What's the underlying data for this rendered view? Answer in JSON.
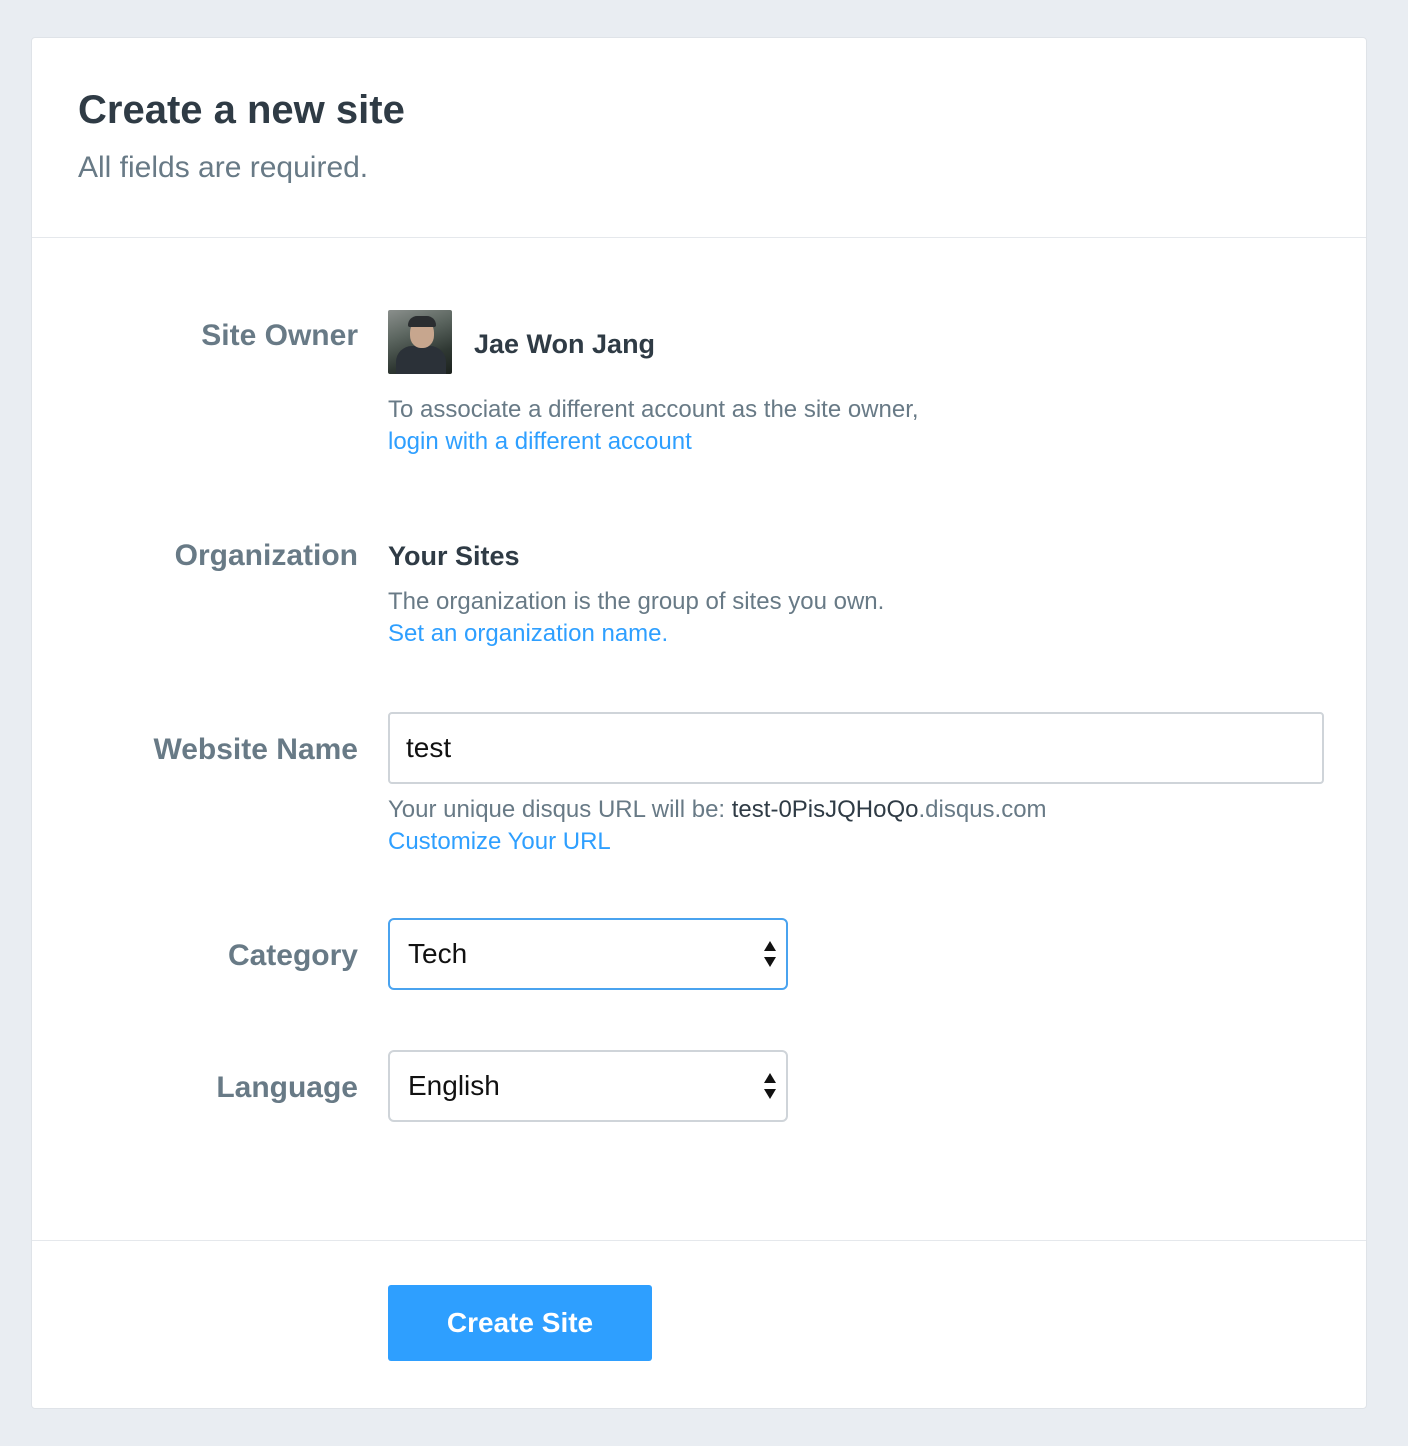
{
  "page": {
    "title": "Create a new site",
    "subtitle": "All fields are required."
  },
  "site_owner": {
    "label": "Site Owner",
    "name": "Jae Won Jang",
    "help": "To associate a different account as the site owner,",
    "link": "login with a different account"
  },
  "organization": {
    "label": "Organization",
    "name": "Your Sites",
    "help": "The organization is the group of sites you own.",
    "link": "Set an organization name."
  },
  "website_name": {
    "label": "Website Name",
    "value": "test",
    "url_prefix": "Your unique disqus URL will be: ",
    "url_slug": "test-0PisJQHoQo",
    "url_suffix": ".disqus.com",
    "link": "Customize Your URL"
  },
  "category": {
    "label": "Category",
    "value": "Tech"
  },
  "language": {
    "label": "Language",
    "value": "English"
  },
  "actions": {
    "submit_label": "Create Site",
    "primary_color": "#2e9fff"
  }
}
